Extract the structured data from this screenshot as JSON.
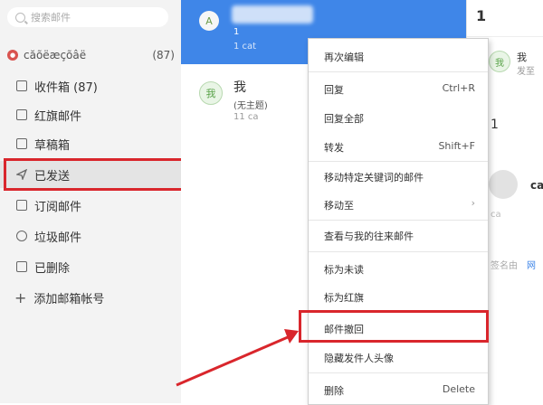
{
  "sidebar": {
    "search_placeholder": "搜索邮件",
    "account": {
      "name": "căõëæçõâë",
      "count": "(87)"
    },
    "folders": [
      {
        "label": "收件箱 (87)",
        "icon": "inbox-icon"
      },
      {
        "label": "红旗邮件",
        "icon": "flag-icon"
      },
      {
        "label": "草稿箱",
        "icon": "draft-icon"
      },
      {
        "label": "已发送",
        "icon": "send-icon"
      },
      {
        "label": "订阅邮件",
        "icon": "subscription-icon"
      },
      {
        "label": "垃圾邮件",
        "icon": "spam-icon"
      },
      {
        "label": "已删除",
        "icon": "trash-icon"
      }
    ],
    "add_account": "添加邮箱帐号"
  },
  "list": {
    "item1": {
      "avatar": "A",
      "line1": "1",
      "line2": "1 cat"
    },
    "item2": {
      "avatar": "我",
      "from": "我",
      "subject": "(无主题)",
      "meta": "11 ca"
    }
  },
  "preview": {
    "count": "1",
    "avatar": "我",
    "me": "我",
    "sent": "发至",
    "one": "1",
    "sender": "ca",
    "sender2": "ca",
    "sig": "签名由",
    "forward": "网"
  },
  "context_menu": {
    "items": [
      {
        "label": "再次编辑",
        "shortcut": ""
      },
      {
        "label": "回复",
        "shortcut": "Ctrl+R"
      },
      {
        "label": "回复全部",
        "shortcut": ""
      },
      {
        "label": "转发",
        "shortcut": "Shift+F"
      },
      {
        "label": "移动特定关键词的邮件",
        "shortcut": ""
      },
      {
        "label": "移动至",
        "shortcut": ""
      },
      {
        "label": "查看与我的往来邮件",
        "shortcut": ""
      },
      {
        "label": "标为未读",
        "shortcut": ""
      },
      {
        "label": "标为红旗",
        "shortcut": ""
      },
      {
        "label": "邮件撤回",
        "shortcut": ""
      },
      {
        "label": "隐藏发件人头像",
        "shortcut": ""
      },
      {
        "label": "删除",
        "shortcut": "Delete"
      }
    ],
    "submenu_arrow": "›"
  },
  "colors": {
    "accent": "#3f86e8",
    "highlight": "#d9262c"
  }
}
